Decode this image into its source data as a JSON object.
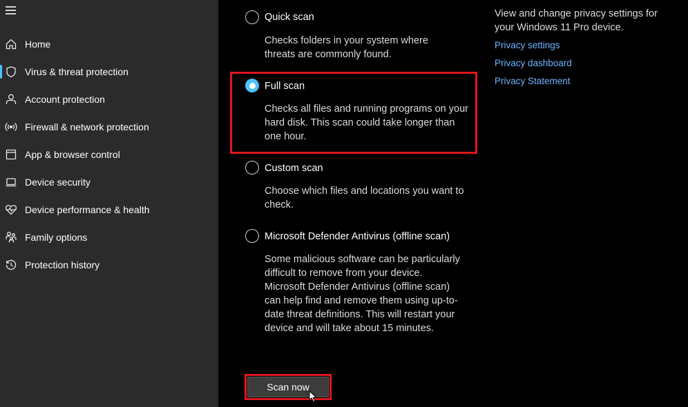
{
  "sidebar": {
    "menu_icon": "hamburger-menu-icon",
    "active_accent": "#4cc2ff",
    "items": [
      {
        "label": "Home",
        "icon": "home-icon",
        "active": false
      },
      {
        "label": "Virus & threat protection",
        "icon": "shield-icon",
        "active": true
      },
      {
        "label": "Account protection",
        "icon": "person-icon",
        "active": false
      },
      {
        "label": "Firewall & network protection",
        "icon": "wireless-signal-icon",
        "active": false
      },
      {
        "label": "App & browser control",
        "icon": "app-window-icon",
        "active": false
      },
      {
        "label": "Device security",
        "icon": "laptop-icon",
        "active": false
      },
      {
        "label": "Device performance & health",
        "icon": "heart-pulse-icon",
        "active": false
      },
      {
        "label": "Family options",
        "icon": "family-icon",
        "active": false
      },
      {
        "label": "Protection history",
        "icon": "history-icon",
        "active": false
      }
    ]
  },
  "scan_options": {
    "selected": "full",
    "options": [
      {
        "id": "quick",
        "title": "Quick scan",
        "description": "Checks folders in your system where threats are commonly found."
      },
      {
        "id": "full",
        "title": "Full scan",
        "description": "Checks all files and running programs on your hard disk. This scan could take longer than one hour."
      },
      {
        "id": "custom",
        "title": "Custom scan",
        "description": "Choose which files and locations you want to check."
      },
      {
        "id": "offline",
        "title": "Microsoft Defender Antivirus (offline scan)",
        "description": "Some malicious software can be particularly difficult to remove from your device. Microsoft Defender Antivirus (offline scan) can help find and remove them using up-to-date threat definitions. This will restart your device and will take about 15 minutes."
      }
    ],
    "scan_button_label": "Scan now"
  },
  "privacy": {
    "description": "View and change privacy settings for your Windows 11 Pro device.",
    "links": [
      "Privacy settings",
      "Privacy dashboard",
      "Privacy Statement"
    ]
  },
  "colors": {
    "highlight": "#e0161e",
    "link": "#6cb6ff",
    "radio_checked": "#4cc2ff"
  }
}
